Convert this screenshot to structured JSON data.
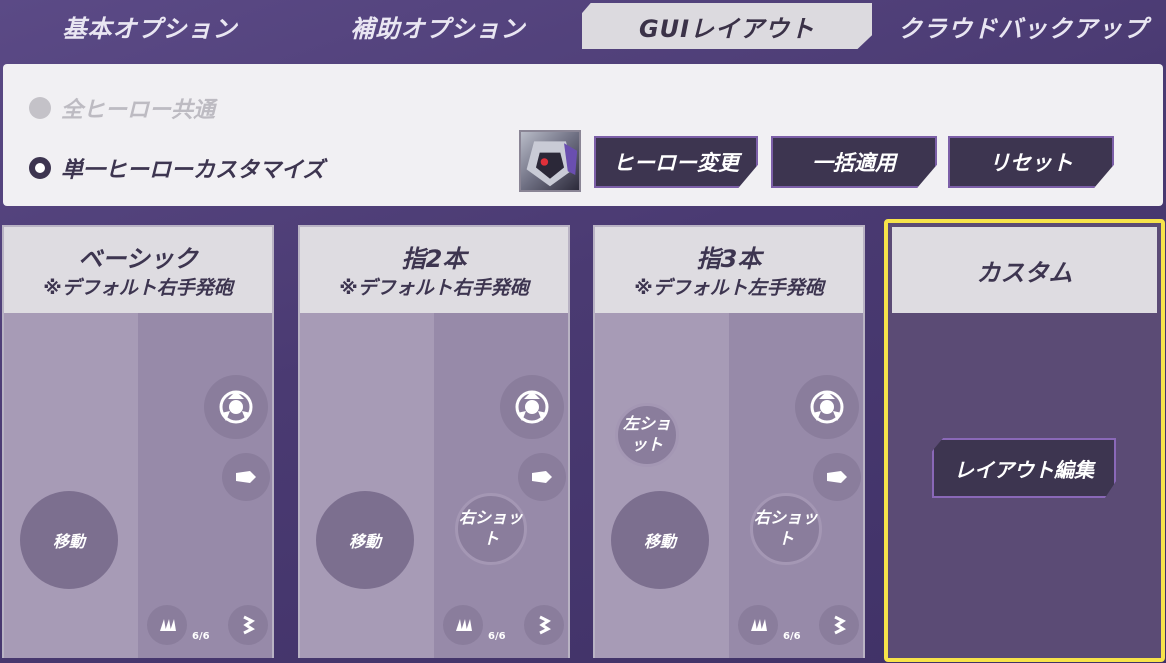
{
  "tabs": [
    {
      "label": "基本オプション"
    },
    {
      "label": "補助オプション"
    },
    {
      "label": "GUIレイアウト"
    },
    {
      "label": "クラウドバックアップ"
    }
  ],
  "options": {
    "radio_common": "全ヒーロー共通",
    "radio_single": "単一ヒーローカスタマイズ",
    "buttons": {
      "hero_change": "ヒーロー変更",
      "apply_all": "一括適用",
      "reset": "リセット"
    }
  },
  "layouts": [
    {
      "title": "ベーシック",
      "subtitle": "※デフォルト右手発砲",
      "move": "移動",
      "ammo": "6/6"
    },
    {
      "title": "指2本",
      "subtitle": "※デフォルト右手発砲",
      "move": "移動",
      "right_shot": "右ショット",
      "ammo": "6/6"
    },
    {
      "title": "指3本",
      "subtitle": "※デフォルト左手発砲",
      "move": "移動",
      "left_shot": "左ショット",
      "right_shot": "右ショット",
      "ammo": "6/6"
    }
  ],
  "custom": {
    "title": "カスタム",
    "edit_label": "レイアウト編集"
  },
  "colors": {
    "accent_border": "#f7e34a",
    "button_bg": "#3d3550"
  }
}
